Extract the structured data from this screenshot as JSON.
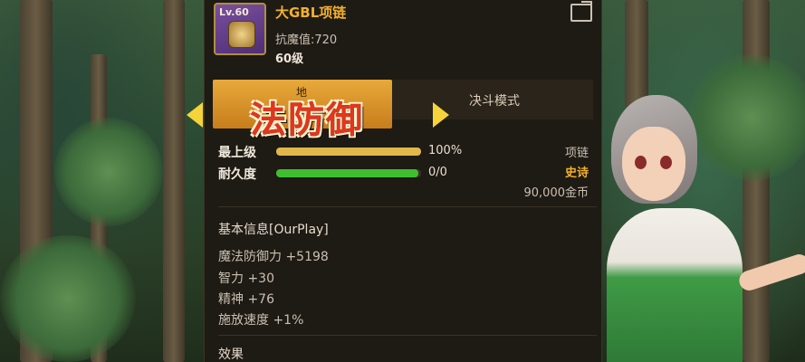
{
  "item": {
    "level_badge": "Lv.60",
    "name": "大GBL项链",
    "magic_resist": "抗魔值:720",
    "level": "60级"
  },
  "tabs": {
    "earth": "地",
    "duel": "决斗模式"
  },
  "banner_title": "法防御",
  "progress": {
    "upgrade_label": "最上级",
    "upgrade_percent": "100%",
    "upgrade_fill": 1.0,
    "durability_label": "耐久度",
    "durability_value": "0/0",
    "durability_fill": 0.98
  },
  "info_right": {
    "type": "项链",
    "rarity": "史诗",
    "price": "90,000金币"
  },
  "basic_info": {
    "title": "基本信息[OurPlay]",
    "stats": [
      "魔法防御力 +5198",
      "智力 +30",
      "精神 +76",
      "施放速度 +1%"
    ]
  },
  "effects_title": "效果",
  "colors": {
    "item_name": "#f2b12a",
    "rarity": "#f2b12a",
    "upgrade_bar": "#e2b74a",
    "durability_bar": "#3fbf2f",
    "banner_text": "#e0371d",
    "arrow": "#f5d43b"
  }
}
